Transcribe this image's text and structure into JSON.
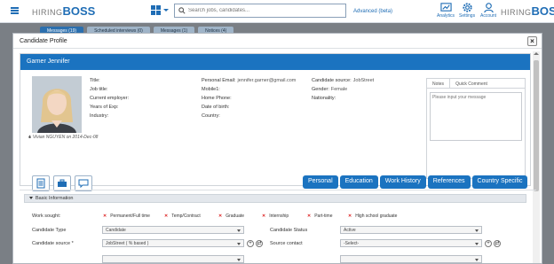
{
  "app": {
    "logo_prefix": "HIRING",
    "logo_suffix": "BOSS",
    "search_placeholder": "Search jobs, candidates...",
    "advanced_label": "Advanced (beta)",
    "nav": [
      {
        "label": "Analytics",
        "icon": "analytics-icon"
      },
      {
        "label": "Settings",
        "icon": "gear-icon"
      },
      {
        "label": "Account",
        "icon": "user-icon"
      }
    ],
    "bg_tabs": [
      "Messages (19)",
      "Scheduled interviews (0)",
      "Messages (1)",
      "Notices (4)"
    ]
  },
  "modal": {
    "title": "Candidate Profile",
    "close_label": "×"
  },
  "candidate": {
    "name": "Garner Jennifer",
    "creator": "Vivian NGUYEN on 2014-Dec-08",
    "col1": [
      {
        "label": "Title:",
        "value": ""
      },
      {
        "label": "Job title:",
        "value": ""
      },
      {
        "label": "Current employer:",
        "value": ""
      },
      {
        "label": "Years of Exp:",
        "value": ""
      },
      {
        "label": "Industry:",
        "value": ""
      }
    ],
    "col2": [
      {
        "label": "Personal Email:",
        "value": "jennifer.garner@gmail.com"
      },
      {
        "label": "Mobile1:",
        "value": ""
      },
      {
        "label": "Home Phone:",
        "value": ""
      },
      {
        "label": "Date of birth:",
        "value": ""
      },
      {
        "label": "Country:",
        "value": ""
      }
    ],
    "col3": [
      {
        "label": "Candidate source:",
        "value": "JobStreet"
      },
      {
        "label": "Gender:",
        "value": "Female"
      },
      {
        "label": "Nationality:",
        "value": ""
      }
    ]
  },
  "notes": {
    "tabs": [
      "Notes",
      "Quick Comment"
    ],
    "placeholder": "Please input your message"
  },
  "profile_tabs": [
    "Personal",
    "Education",
    "Work History",
    "References",
    "Country Specific"
  ],
  "basic_info": {
    "title": "Basic Information",
    "work_sought_label": "Work sought:",
    "work_options": [
      "Permanent/Full time",
      "Temp/Contract",
      "Graduate",
      "Internship",
      "Part-time",
      "High school graduate"
    ],
    "candidate_type_label": "Candidate Type",
    "candidate_type_value": "Candidate",
    "candidate_status_label": "Candidate Status",
    "candidate_status_value": "Active",
    "candidate_source_label": "Candidate source *",
    "candidate_source_value": "JobStreet ( % based )",
    "source_contact_label": "Source contact",
    "source_contact_value": "-Select-"
  },
  "colors": {
    "brand_blue": "#1b73c0",
    "danger": "#dd2222"
  }
}
